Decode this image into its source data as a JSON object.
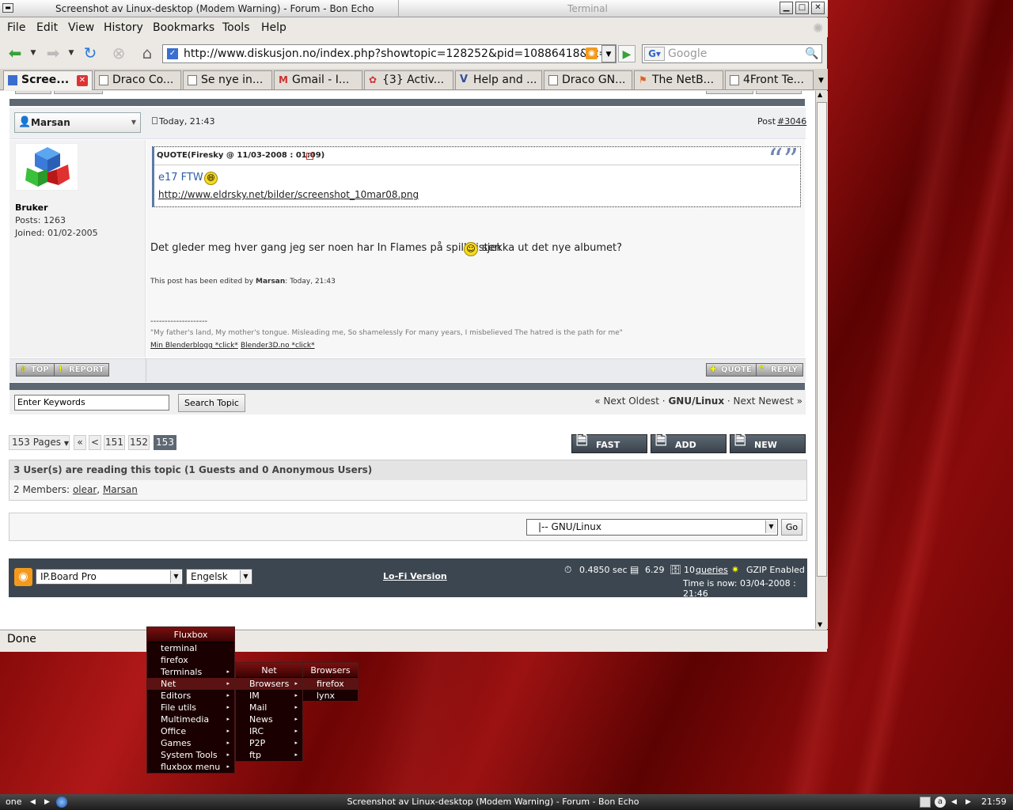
{
  "window": {
    "title": "Screenshot av Linux-desktop (Modem Warning) - Forum - Bon Echo",
    "terminal_title": "Terminal"
  },
  "menubar": [
    "File",
    "Edit",
    "View",
    "History",
    "Bookmarks",
    "Tools",
    "Help"
  ],
  "navbar": {
    "url": "http://www.diskusjon.no/index.php?showtopic=128252&pid=10886418&st=3",
    "search_placeholder": "Google"
  },
  "tabs": [
    "Scree...",
    "Draco Co...",
    "Se nye in...",
    "Gmail - I...",
    "{3} Activ...",
    "Help and ...",
    "Draco GN...",
    "The NetB...",
    "4Front Te..."
  ],
  "post": {
    "author": "Marsan",
    "date": "Today, 21:43",
    "post_label": "Post",
    "post_num": "#3046",
    "group": "Bruker",
    "posts": "Posts: 1263",
    "joined": "Joined: 01/02-2005",
    "quote_header": "QUOTE(Firesky @ 11/03-2008 : 01:09)",
    "quote_text": "e17 FTW",
    "quote_link": "http://www.eldrsky.net/bilder/screenshot_10mar08.png",
    "body_part1": "Det gleder meg hver gang jeg ser noen har In Flames på spillelisten",
    "body_part2": "sjekka ut det nye albumet?",
    "edit_prefix": "This post has been edited by",
    "edit_user": "Marsan",
    "edit_suffix": ": Today, 21:43",
    "sig_line": "--------------------",
    "sig_quote": "\"My father's land, My mother's tongue. Misleading me, So shamelessly For many years, I misbelieved The hatred is the path for me\"",
    "sig_link1": "Min Blenderblogg *click*",
    "sig_link2": "Blender3D.no *click*",
    "btn_top": "TOP",
    "btn_report": "REPORT",
    "btn_quote": "QUOTE",
    "btn_reply": "REPLY"
  },
  "search": {
    "input_value": "Enter Keywords",
    "button": "Search Topic",
    "prev": "« Next Oldest",
    "sep1": "·",
    "forum": "GNU/Linux",
    "sep2": "·",
    "next": "Next Newest »"
  },
  "pagination": {
    "pages_label": "153 Pages",
    "first": "«",
    "prev": "<",
    "p1": "151",
    "p2": "152",
    "current": "153"
  },
  "actions": {
    "fast_reply": "FAST REPLY",
    "add_reply": "ADD REPLY",
    "new_topic": "NEW TOPIC"
  },
  "readers": {
    "title": "3 User(s) are reading this topic (1 Guests and 0 Anonymous Users)",
    "members_prefix": "2 Members:",
    "member1": "olear",
    "comma": ",",
    "member2": "Marsan"
  },
  "jump": {
    "selected": "|-- GNU/Linux",
    "go": "Go"
  },
  "footer": {
    "skin": "IP.Board Pro",
    "lang": "Engelsk",
    "lofi": "Lo-Fi Version",
    "time_exec": "0.4850 sec",
    "load": "6.29",
    "queries_num": "10",
    "queries_label": "queries",
    "gzip": "GZIP Enabled",
    "time_now": "Time is now: 03/04-2008 : 21:46"
  },
  "status": "Done",
  "fluxbox": {
    "title": "Fluxbox",
    "items": [
      "terminal",
      "firefox",
      "Terminals",
      "Net",
      "Editors",
      "File utils",
      "Multimedia",
      "Office",
      "Games",
      "System Tools",
      "fluxbox menu"
    ],
    "net_title": "Net",
    "net_items": [
      "Browsers",
      "IM",
      "Mail",
      "News",
      "IRC",
      "P2P",
      "ftp"
    ],
    "browsers_title": "Browsers",
    "browsers_items": [
      "firefox",
      "lynx"
    ]
  },
  "taskbar": {
    "workspace": "one",
    "task": "Screenshot av Linux-desktop (Modem Warning) - Forum - Bon Echo",
    "clock": "21:59"
  },
  "colors": {
    "forum_bar": "#5d6873",
    "desktop": "#8a0b0b",
    "menu_bg": "#1a0000"
  }
}
